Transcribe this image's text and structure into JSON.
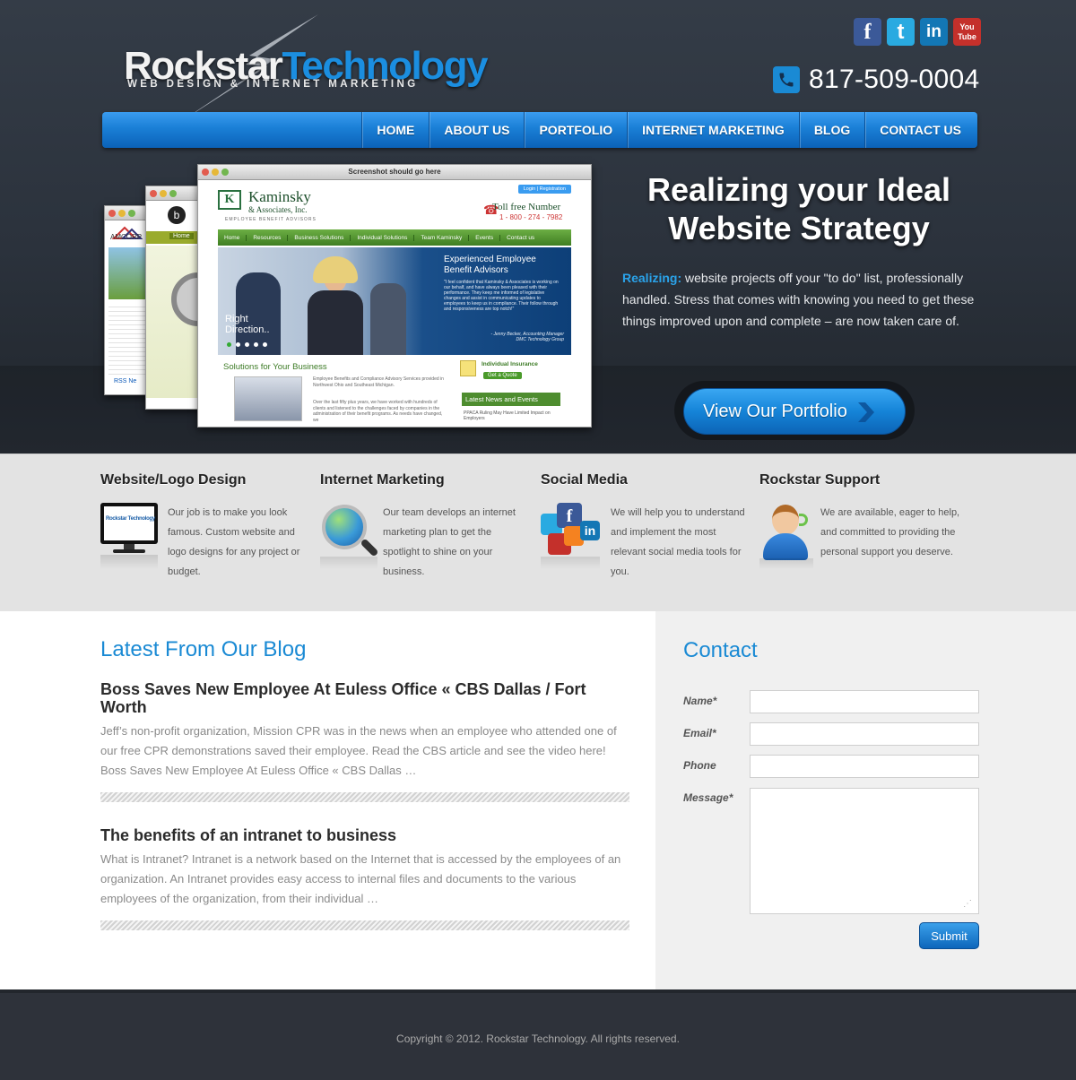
{
  "header": {
    "logo_main_1": "Rockstar",
    "logo_main_2": "Technology",
    "logo_tagline": "WEB DESIGN & INTERNET MARKETING",
    "phone": "817-509-0004",
    "social": [
      {
        "name": "facebook-icon",
        "label": "f",
        "color": "#3b5998"
      },
      {
        "name": "twitter-icon",
        "label": "t",
        "color": "#29aae1"
      },
      {
        "name": "linkedin-icon",
        "label": "in",
        "color": "#1377b5"
      },
      {
        "name": "youtube-icon",
        "label": "You Tube",
        "color": "#c4302b"
      }
    ],
    "nav": [
      "HOME",
      "ABOUT US",
      "PORTFOLIO",
      "INTERNET MARKETING",
      "BLOG",
      "CONTACT US"
    ]
  },
  "hero": {
    "shot_title": "Screenshot should go here",
    "shot_login": "Login | Registration",
    "shot_company": "Kaminsky",
    "shot_company_sub": "& Associates, Inc.",
    "shot_tagline": "EMPLOYEE BENEFIT ADVISORS",
    "shot_tollfree": "Toll free Number",
    "shot_tollfree_num": "1 - 800 - 274 - 7982",
    "shot_nav": [
      "Home",
      "Resources",
      "Business Solutions",
      "Individual Solutions",
      "Team Kaminsky",
      "Events",
      "Contact us"
    ],
    "shot_banner_head": "Experienced Employee Benefit Advisors",
    "shot_banner_quote": "\"I feel confident that Kaminsky & Associates is working on our behalf, and have always been pleased with their performance. They keep me informed of legislative changes and assist in communicating updates to employees to keep us in compliance. Their follow through and responsiveness are top notch!\"",
    "shot_banner_author": "- Jenny Becker, Accounting Manager DMC Technology Group",
    "shot_right_direction": "Right Direction..",
    "shot_solutions": "Solutions for Your Business",
    "shot_sol_text": "Employee Benefits and Compliance Advisory Services provided in Northwest Ohio and Southeast Michigan.",
    "shot_sol_text2": "Over the last fifty plus years, we have worked with hundreds of clients and listened to the challenges faced by companies in the administration of their benefit programs. As needs have changed, we",
    "shot_ind_ins": "Individual Insurance",
    "shot_get_quote": "Get a Quote",
    "shot_news": "Latest News and Events",
    "shot_news_item": "PPACA Ruling May Have Limited Impact on Employers",
    "shot_back_amcor": "AMCORP",
    "shot_back_rss": "RSS Ne",
    "shot_back_home": "Home",
    "title": "Realizing your Ideal Website Strategy",
    "text_lead": "Realizing:",
    "text_body": " website projects off your \"to do\" list, professionally handled. Stress that comes with knowing you need to get these things improved upon and complete – are now taken care of.",
    "cta": "View Our Portfolio"
  },
  "services": [
    {
      "title": "Website/Logo Design",
      "text": "Our job is to make you look famous. Custom website and logo designs for any project or budget.",
      "icon": "monitor-icon",
      "mini_logo": "Rockstar Technology"
    },
    {
      "title": "Internet Marketing",
      "text": "Our team develops an internet marketing plan to get the spotlight to shine on your business.",
      "icon": "globe-magnifier-icon"
    },
    {
      "title": "Social Media",
      "text": "We will help you to understand and implement the most relevant social media tools for you.",
      "icon": "social-media-icon"
    },
    {
      "title": "Rockstar Support",
      "text": "We are available, eager to help, and committed to providing the personal support you deserve.",
      "icon": "support-agent-icon"
    }
  ],
  "blog": {
    "title": "Latest From Our Blog",
    "posts": [
      {
        "title": "Boss Saves New Employee At Euless Office « CBS Dallas / Fort Worth",
        "body": "Jeff’s non-profit organization, Mission CPR was in the news when an employee who attended one of our free CPR demonstrations saved their employee. Read the CBS article and see the video here! Boss Saves New Employee At Euless Office « CBS Dallas …"
      },
      {
        "title": "The benefits of an intranet to business",
        "body": "What is Intranet? Intranet is a network based on the Internet that is accessed by the employees of an organization. An Intranet provides easy access to internal files and documents to the various employees of the organization, from their individual …"
      }
    ]
  },
  "contact": {
    "title": "Contact",
    "name_label": "Name*",
    "email_label": "Email*",
    "phone_label": "Phone",
    "message_label": "Message*",
    "submit": "Submit"
  },
  "footer": {
    "copyright": "Copyright © 2012. Rockstar Technology. All rights reserved."
  }
}
